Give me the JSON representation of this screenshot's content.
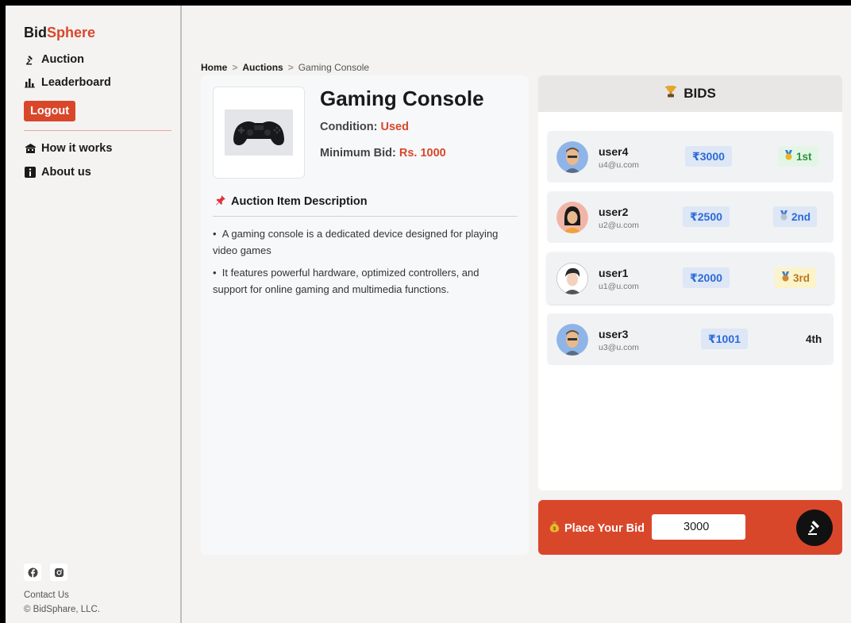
{
  "sidebar": {
    "brand_part1": "Bid",
    "brand_part2": "Sphere",
    "nav": [
      {
        "label": "Auction",
        "icon": "gavel-icon"
      },
      {
        "label": "Leaderboard",
        "icon": "bar-chart-icon"
      }
    ],
    "logout_label": "Logout",
    "info": [
      {
        "label": "How it works",
        "icon": "building-icon"
      },
      {
        "label": "About us",
        "icon": "info-icon"
      }
    ],
    "social": [
      "facebook-icon",
      "instagram-icon"
    ],
    "contact_label": "Contact Us",
    "copyright": "© BidSphare, LLC."
  },
  "breadcrumb": {
    "home": "Home",
    "sep": ">",
    "auctions": "Auctions",
    "current": "Gaming Console"
  },
  "item": {
    "title": "Gaming Console",
    "condition_label": "Condition:",
    "condition_value": "Used",
    "min_bid_label": "Minimum Bid:",
    "min_bid_value": "Rs. 1000",
    "description_heading": "Auction Item Description",
    "description": [
      "A gaming console is a dedicated device designed for playing video games",
      "It features powerful hardware, optimized controllers, and support for online gaming and multimedia functions."
    ]
  },
  "bids": {
    "header": "BIDS",
    "rows": [
      {
        "user": "user4",
        "email": "u4@u.com",
        "amount": "₹3000",
        "rank": "1st"
      },
      {
        "user": "user2",
        "email": "u2@u.com",
        "amount": "₹2500",
        "rank": "2nd"
      },
      {
        "user": "user1",
        "email": "u1@u.com",
        "amount": "₹2000",
        "rank": "3rd"
      },
      {
        "user": "user3",
        "email": "u3@u.com",
        "amount": "₹1001",
        "rank": "4th"
      }
    ]
  },
  "place_bid": {
    "label": "Place Your Bid",
    "value": "3000"
  },
  "colors": {
    "accent": "#d9472b",
    "amount_text": "#2d6ad6",
    "amount_bg": "#dde7f6",
    "rank1_bg": "#e3f6e6",
    "rank2_bg": "#dde7f6",
    "rank3_bg": "#fbf3c9"
  }
}
